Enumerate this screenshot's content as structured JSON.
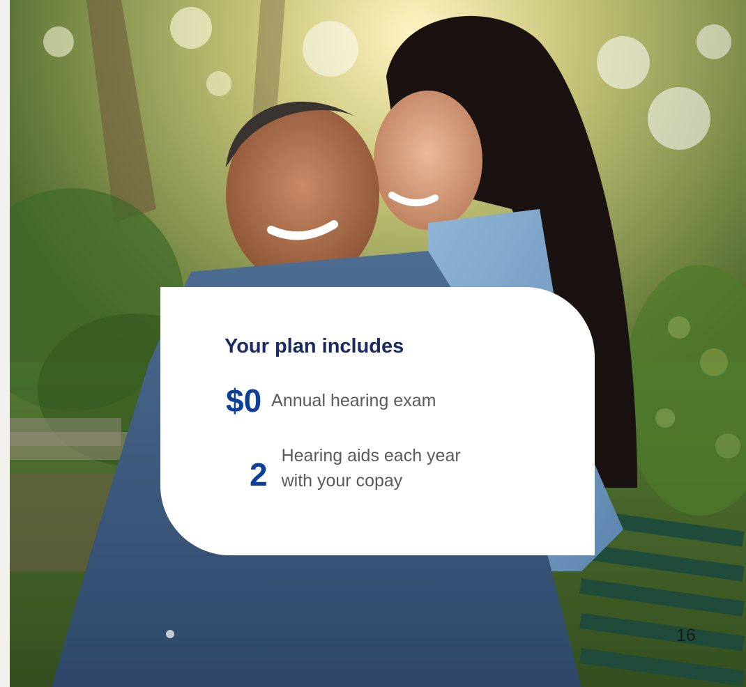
{
  "card": {
    "title": "Your plan includes",
    "benefits": [
      {
        "amount": "$0",
        "description_lines": [
          "Annual hearing exam"
        ]
      },
      {
        "amount": "2",
        "description_lines": [
          "Hearing aids each year",
          "with your copay"
        ]
      }
    ]
  },
  "page_number": "16",
  "colors": {
    "title": "#1b2a63",
    "accent_blue": "#0b3f9a",
    "body_text": "#5a5a5a",
    "card_background": "#ffffff",
    "page_background": "#f3f1ee"
  }
}
